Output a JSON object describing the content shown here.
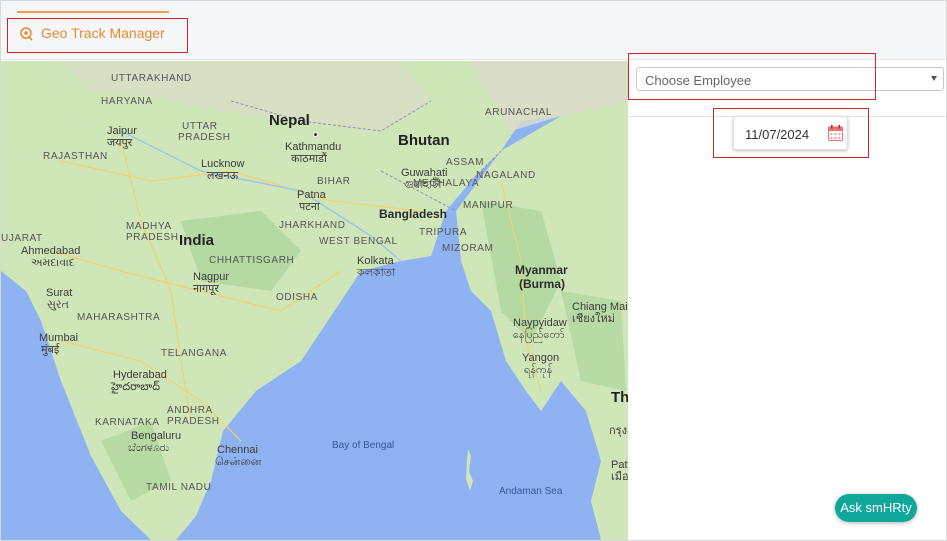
{
  "tab": {
    "label": "Geo Track Manager",
    "icon": "geo-track-icon"
  },
  "filters": {
    "employee_placeholder": "Choose Employee",
    "date_value": "11/07/2024"
  },
  "chat": {
    "label": "Ask smHRty"
  },
  "map": {
    "labels": {
      "nepal": "Nepal",
      "bhutan": "Bhutan",
      "bangladesh": "Bangladesh",
      "india": "India",
      "myanmar": "Myanmar",
      "burma": "(Burma)",
      "uttarakhand": "UTTARAKHAND",
      "haryana": "HARYANA",
      "uttar_pradesh_1": "UTTAR",
      "uttar_pradesh_2": "PRADESH",
      "rajasthan": "RAJASTHAN",
      "jaipur": "Jaipur",
      "jaipur_local": "जयपुर",
      "lucknow": "Lucknow",
      "lucknow_local": "लखनऊ",
      "kathmandu": "Kathmandu",
      "kathmandu_local": "काठमाडौं",
      "bihar": "BIHAR",
      "patna": "Patna",
      "patna_local": "पटना",
      "guwahati": "Guwahati",
      "guwahati_local": "গুৱাহাটী",
      "assam": "ASSAM",
      "meghalaya": "MEGHALAYA",
      "arunachal": "ARUNACHAL",
      "nagaland": "NAGALAND",
      "manipur": "MANIPUR",
      "tripura": "TRIPURA",
      "mizoram": "MIZORAM",
      "jharkhand": "JHARKHAND",
      "west_bengal": "WEST BENGAL",
      "kolkata": "Kolkata",
      "kolkata_local": "কলকাতা",
      "madhya_1": "MADHYA",
      "madhya_2": "PRADESH",
      "gujarat": "UJARAT",
      "ahmedabad": "Ahmedabad",
      "ahmedabad_local": "અમદાવાદ",
      "chhattisgarh": "CHHATTISGARH",
      "nagpur": "Nagpur",
      "nagpur_local": "नागपूर",
      "odisha": "ODISHA",
      "surat": "Surat",
      "surat_local": "સુરત",
      "maharashtra": "MAHARASHTRA",
      "mumbai": "Mumbai",
      "mumbai_local": "मुंबई",
      "telangana": "TELANGANA",
      "hyderabad": "Hyderabad",
      "hyderabad_local": "హైదరాబాద్",
      "andhra_1": "ANDHRA",
      "andhra_2": "PRADESH",
      "karnataka": "KARNATAKA",
      "bengaluru": "Bengaluru",
      "bengaluru_local": "ಬೆಂಗಳೂರು",
      "chennai": "Chennai",
      "chennai_local": "சென்னை",
      "tamil_nadu": "TAMIL NADU",
      "bay_of_bengal": "Bay of Bengal",
      "andaman_sea": "Andaman Sea",
      "naypyidaw": "Naypyidaw",
      "naypyidaw_local": "နေပြည်တော်",
      "yangon": "Yangon",
      "yangon_local": "ရန်ကုန်",
      "chiang_mai": "Chiang Mai",
      "chiang_mai_local": "เชียงใหม่",
      "thailand_partial": "Tha",
      "bangkok_partial": "กรุงเทพ",
      "pattaya_partial": "Patt",
      "pattaya_local_partial": "เมือ"
    }
  },
  "colors": {
    "accent": "#e8892d",
    "highlight": "#c62828",
    "chat": "#11a89c",
    "water": "#8fb3f2",
    "land": "#cfe6b8"
  }
}
